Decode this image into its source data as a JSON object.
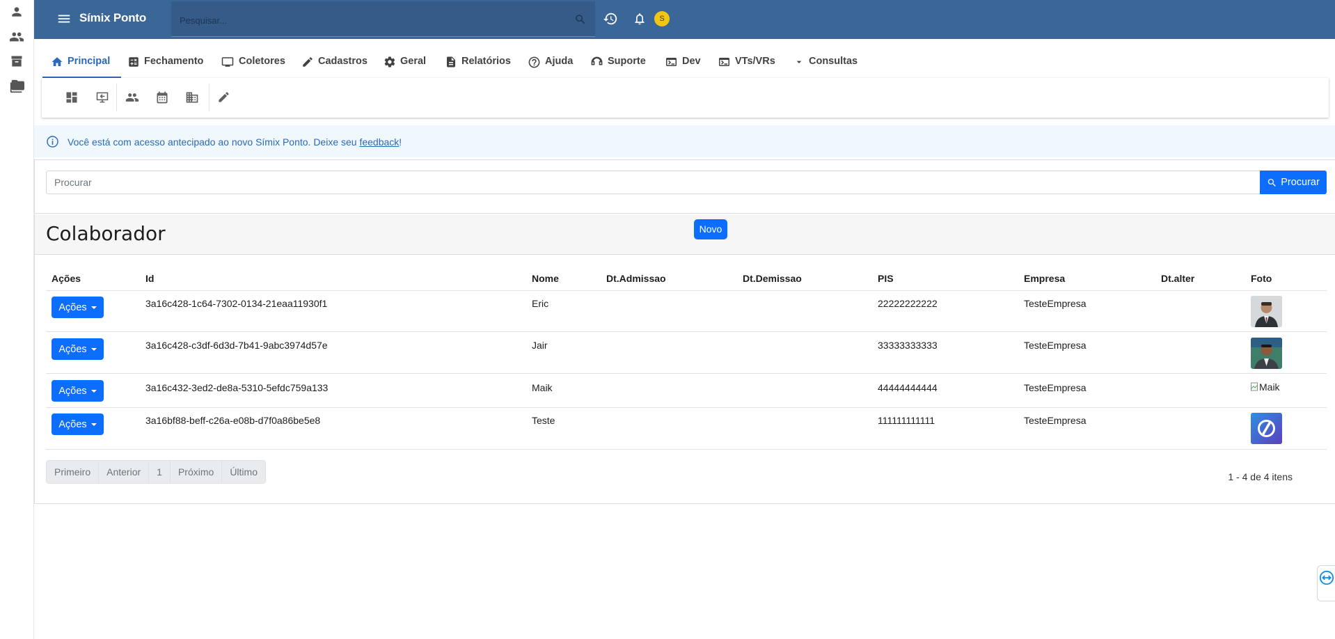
{
  "app": {
    "brand": "Símix Ponto",
    "search_placeholder": "Pesquisar...",
    "avatar_initial": "S"
  },
  "tabs": [
    {
      "label": "Principal",
      "icon": "home-icon",
      "active": true
    },
    {
      "label": "Fechamento",
      "icon": "calculator-icon"
    },
    {
      "label": "Coletores",
      "icon": "monitor-icon"
    },
    {
      "label": "Cadastros",
      "icon": "pencil-icon"
    },
    {
      "label": "Geral",
      "icon": "gear-icon"
    },
    {
      "label": "Relatórios",
      "icon": "document-icon"
    },
    {
      "label": "Ajuda",
      "icon": "help-icon"
    },
    {
      "label": "Suporte",
      "icon": "support-icon"
    },
    {
      "label": "Dev",
      "icon": "terminal-icon"
    },
    {
      "label": "VTs/VRs",
      "icon": "terminal-icon"
    },
    {
      "label": "Consultas",
      "icon": "dropdown-icon"
    }
  ],
  "alert": {
    "text": "Você está com acesso antecipado ao novo Símix Ponto. Deixe seu ",
    "link": "feedback",
    "suffix": "!"
  },
  "search": {
    "placeholder": "Procurar",
    "button_label": "Procurar"
  },
  "card": {
    "title": "Colaborador",
    "new_button": "Novo"
  },
  "table": {
    "columns": [
      "Ações",
      "Id",
      "Nome",
      "Dt.Admissao",
      "Dt.Demissao",
      "PIS",
      "Empresa",
      "Dt.alter",
      "Foto"
    ],
    "action_label": "Ações",
    "rows": [
      {
        "id": "3a16c428-1c64-7302-0134-21eaa11930f1",
        "nome": "Eric",
        "dt_admissao": "",
        "dt_demissao": "",
        "pis": "22222222222",
        "empresa": "TesteEmpresa",
        "dt_alter": "",
        "foto": "photo-eric"
      },
      {
        "id": "3a16c428-c3df-6d3d-7b41-9abc3974d57e",
        "nome": "Jair",
        "dt_admissao": "",
        "dt_demissao": "",
        "pis": "33333333333",
        "empresa": "TesteEmpresa",
        "dt_alter": "",
        "foto": "photo-jair"
      },
      {
        "id": "3a16c432-3ed2-de8a-5310-5efdc759a133",
        "nome": "Maik",
        "dt_admissao": "",
        "dt_demissao": "",
        "pis": "44444444444",
        "empresa": "TesteEmpresa",
        "dt_alter": "",
        "foto_alt": "Maik"
      },
      {
        "id": "3a16bf88-beff-c26a-e08b-d7f0a86be5e8",
        "nome": "Teste",
        "dt_admissao": "",
        "dt_demissao": "",
        "pis": "111111111111",
        "empresa": "TesteEmpresa",
        "dt_alter": "",
        "foto": "photo-logo"
      }
    ]
  },
  "pager": {
    "first": "Primeiro",
    "prev": "Anterior",
    "page": "1",
    "next": "Próximo",
    "last": "Último",
    "summary": "1 - 4 de 4 itens"
  },
  "colors": {
    "topbar": "#3b6698",
    "primary": "#0d6efd",
    "active_tab": "#2c68b8"
  }
}
